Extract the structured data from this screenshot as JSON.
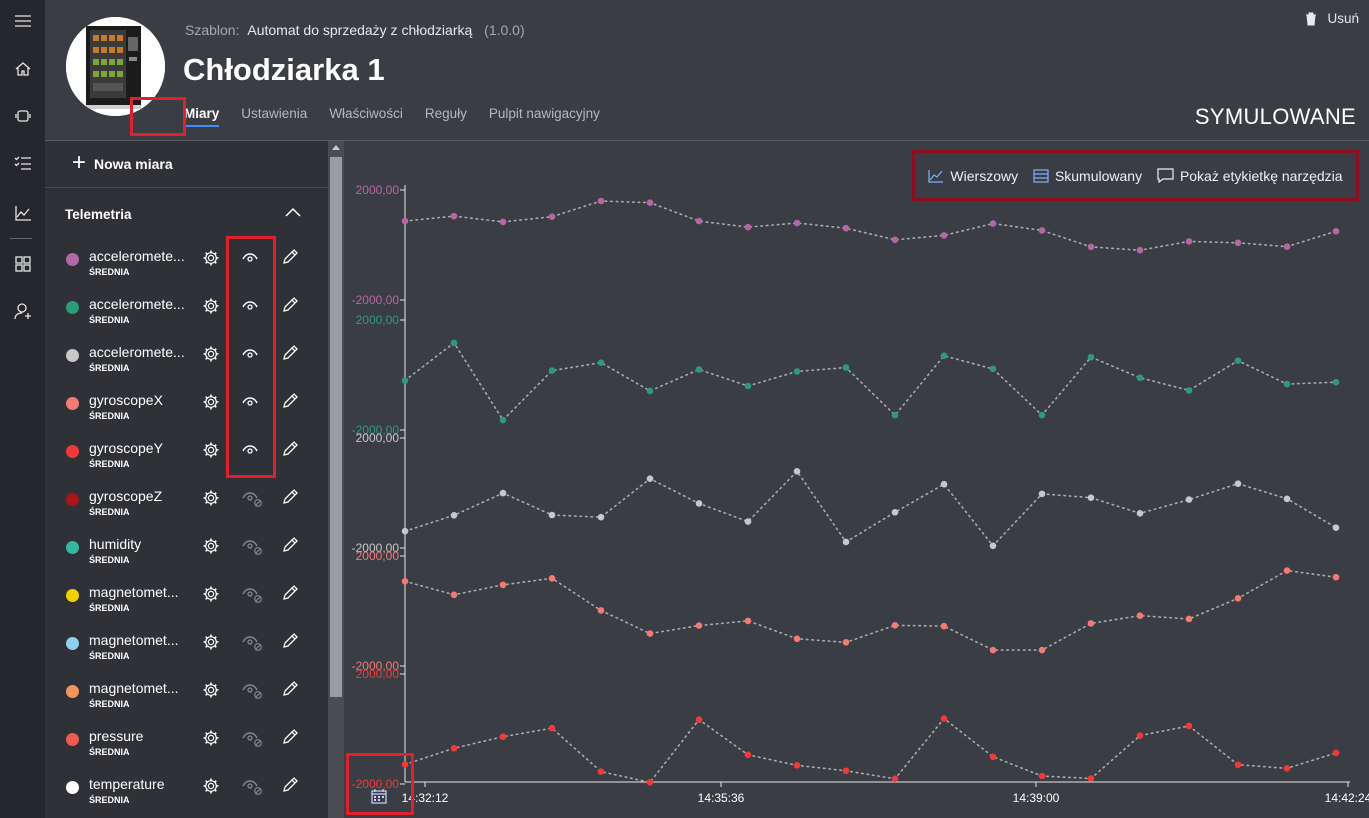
{
  "template": {
    "label": "Szablon:",
    "name": "Automat do sprzedaży z chłodziarką",
    "version": "(1.0.0)"
  },
  "device": {
    "title": "Chłodziarka 1",
    "status": "SYMULOWANE"
  },
  "actions": {
    "delete_label": "Usuń"
  },
  "tabs": [
    {
      "label": "Miary",
      "active": true
    },
    {
      "label": "Ustawienia"
    },
    {
      "label": "Właściwości"
    },
    {
      "label": "Reguły"
    },
    {
      "label": "Pulpit nawigacyjny"
    }
  ],
  "sidebar": {
    "new_measure_label": "Nowa miara",
    "section_title": "Telemetria",
    "items": [
      {
        "name": "acceleromete...",
        "agg": "ŚREDNIA",
        "color": "#b467a8",
        "visible": true
      },
      {
        "name": "acceleromete...",
        "agg": "ŚREDNIA",
        "color": "#2f9a78",
        "visible": true
      },
      {
        "name": "acceleromete...",
        "agg": "ŚREDNIA",
        "color": "#c8c8c8",
        "visible": true
      },
      {
        "name": "gyroscopeX",
        "agg": "ŚREDNIA",
        "color": "#f47a76",
        "visible": true
      },
      {
        "name": "gyroscopeY",
        "agg": "ŚREDNIA",
        "color": "#f03a3a",
        "visible": true
      },
      {
        "name": "gyroscopeZ",
        "agg": "ŚREDNIA",
        "color": "#a8161c",
        "visible": false
      },
      {
        "name": "humidity",
        "agg": "ŚREDNIA",
        "color": "#36b7a0",
        "visible": false
      },
      {
        "name": "magnetomet...",
        "agg": "ŚREDNIA",
        "color": "#efd000",
        "visible": false
      },
      {
        "name": "magnetomet...",
        "agg": "ŚREDNIA",
        "color": "#8ed0ee",
        "visible": false
      },
      {
        "name": "magnetomet...",
        "agg": "ŚREDNIA",
        "color": "#f5935c",
        "visible": false
      },
      {
        "name": "pressure",
        "agg": "ŚREDNIA",
        "color": "#ee5a50",
        "visible": false
      },
      {
        "name": "temperature",
        "agg": "ŚREDNIA",
        "color": "#ffffff",
        "visible": false
      }
    ]
  },
  "toolbar": {
    "line_label": "Wierszowy",
    "stacked_label": "Skumulowany",
    "tooltip_label": "Pokaż etykietkę narzędzia"
  },
  "chart_data": {
    "type": "line",
    "layout": "stacked-panels",
    "x_ticks": [
      "14:32:12",
      "14:35:36",
      "14:39:00",
      "14:42:24"
    ],
    "series": [
      {
        "color": "#b467a8",
        "ylim": [
          -2000,
          2000
        ],
        "y_tick_labels": [
          "2000,00",
          "-2000,00"
        ],
        "values": [
          870,
          1050,
          840,
          1030,
          1600,
          1540,
          870,
          650,
          800,
          610,
          190,
          350,
          780,
          530,
          -70,
          -190,
          130,
          80,
          -60,
          500
        ]
      },
      {
        "color": "#2f9a78",
        "ylim": [
          -2000,
          2000
        ],
        "y_tick_labels": [
          "2000,00",
          "-2000,00"
        ],
        "values": [
          -200,
          1170,
          -1640,
          160,
          450,
          -580,
          200,
          -400,
          130,
          270,
          -1460,
          700,
          220,
          -1460,
          650,
          -100,
          -560,
          520,
          -330,
          -260
        ]
      },
      {
        "color": "#c8c8c8",
        "ylim": [
          -2000,
          2000
        ],
        "y_tick_labels": [
          "2000,00",
          "-2000,00"
        ],
        "values": [
          -1390,
          -810,
          -4,
          -800,
          -880,
          520,
          -380,
          -1040,
          790,
          -1780,
          -700,
          320,
          -1920,
          -32,
          -170,
          -740,
          -240,
          340,
          -210,
          -1260
        ]
      },
      {
        "color": "#f47a76",
        "ylim": [
          -2000,
          2000
        ],
        "y_tick_labels": [
          "2000,00",
          "-2000,00"
        ],
        "values": [
          1080,
          590,
          950,
          1190,
          20,
          -820,
          -530,
          -360,
          -1010,
          -1140,
          -520,
          -550,
          -1420,
          -1420,
          -450,
          -170,
          -290,
          460,
          1470,
          1230
        ]
      },
      {
        "color": "#f03a3a",
        "ylim": [
          -2000,
          2000
        ],
        "y_tick_labels": [
          "2000,00",
          "-2000,00"
        ],
        "values": [
          -1290,
          -700,
          -280,
          30,
          -1550,
          -1940,
          340,
          -940,
          -1320,
          -1520,
          -1810,
          380,
          -1010,
          -1710,
          -1800,
          -240,
          110,
          -1300,
          -1430,
          -870
        ]
      }
    ]
  }
}
